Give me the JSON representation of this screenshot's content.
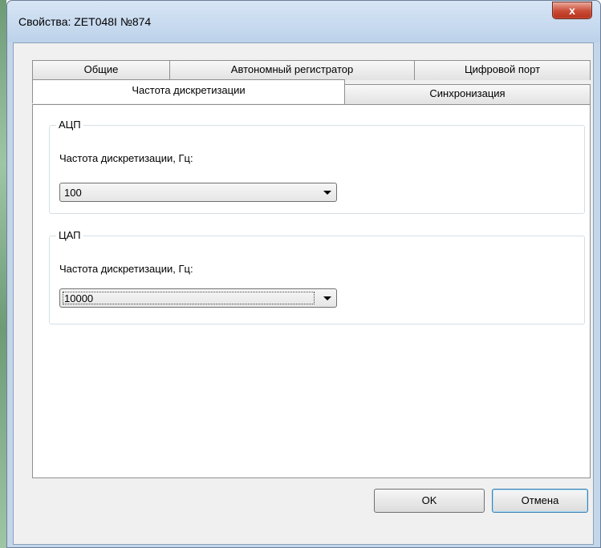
{
  "window": {
    "title": "Свойства: ZET048I №874",
    "close_glyph": "x"
  },
  "tabs": {
    "row1": [
      "Общие",
      "Автономный регистратор",
      "Цифровой порт"
    ],
    "row2": [
      "Частота дискретизации",
      "Синхронизация"
    ],
    "selected": "Частота дискретизации"
  },
  "adc": {
    "title": "АЦП",
    "label": "Частота дискретизации, Гц:",
    "value": "100"
  },
  "dac": {
    "title": "ЦАП",
    "label": "Частота дискретизации, Гц:",
    "value": "10000"
  },
  "buttons": {
    "ok": "OK",
    "cancel": "Отмена"
  },
  "icons": {
    "close": "close-icon",
    "dropdown": "chevron-down-icon"
  },
  "colors": {
    "close_button": "#c94a34",
    "title_bar": "#c4d6ea",
    "default_button_border": "#3c7fb1"
  }
}
